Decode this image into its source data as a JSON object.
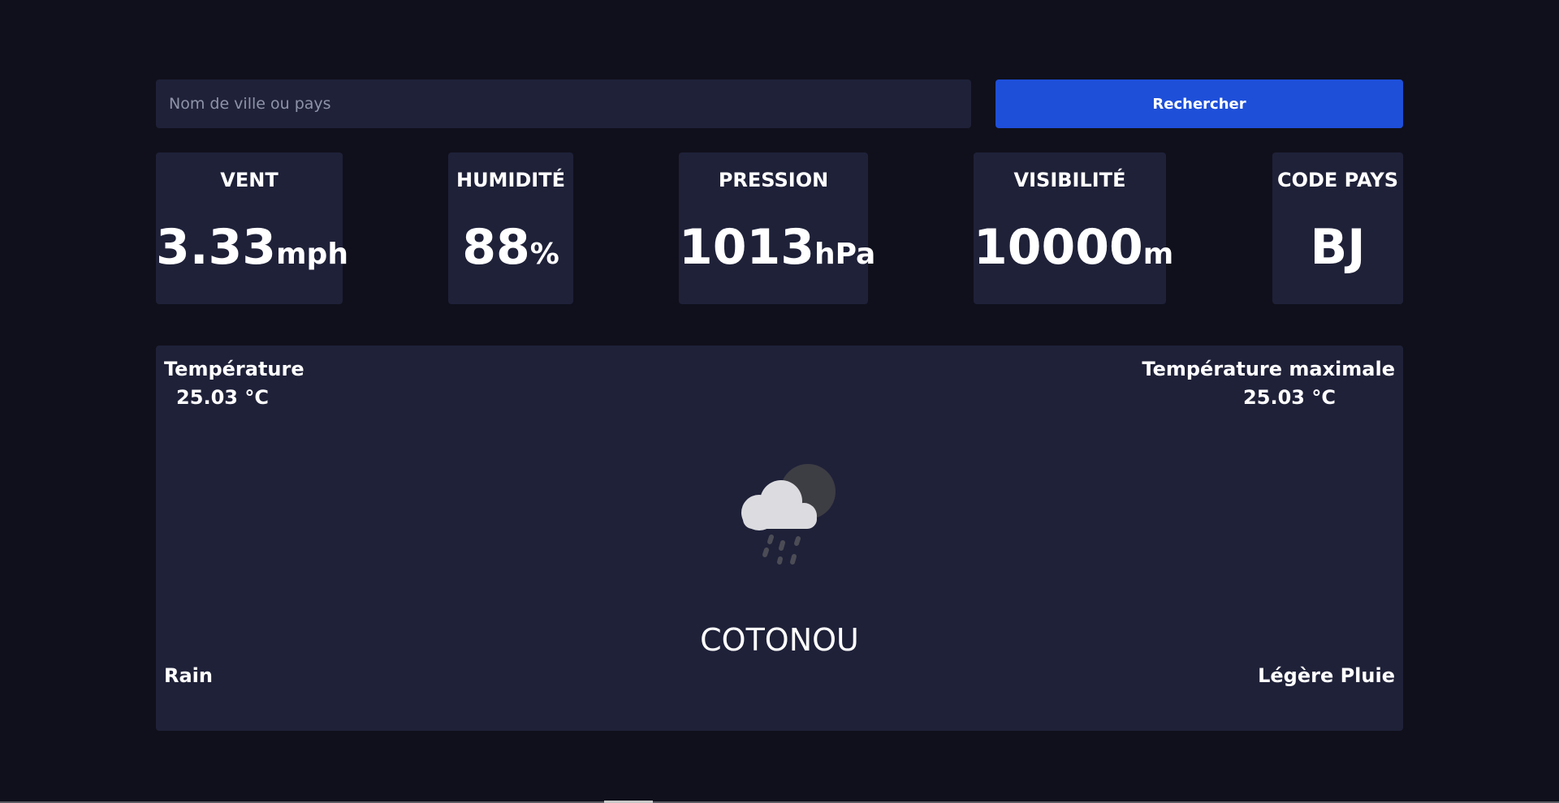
{
  "search": {
    "placeholder": "Nom de ville ou pays",
    "value": "",
    "button_label": "Rechercher"
  },
  "stats": [
    {
      "label": "VENT",
      "value": "3.33",
      "unit": "mph"
    },
    {
      "label": "HUMIDITÉ",
      "value": "88",
      "unit": "%"
    },
    {
      "label": "PRESSION",
      "value": "1013",
      "unit": "hPa"
    },
    {
      "label": "VISIBILITÉ",
      "value": "10000",
      "unit": "m"
    },
    {
      "label": "CODE PAYS",
      "value": "BJ",
      "unit": ""
    }
  ],
  "weather": {
    "temperature_label": "Température",
    "temperature_value": "25.03 °C",
    "max_temperature_label": "Température maximale",
    "max_temperature_value": "25.03 °C",
    "city": "COTONOU",
    "condition": "Rain",
    "description": "Légère Pluie",
    "icon": "cloud-moon-rain-icon"
  },
  "colors": {
    "page_background": "#10101c",
    "card_background": "#1f2139",
    "accent": "#1e4fd9"
  }
}
